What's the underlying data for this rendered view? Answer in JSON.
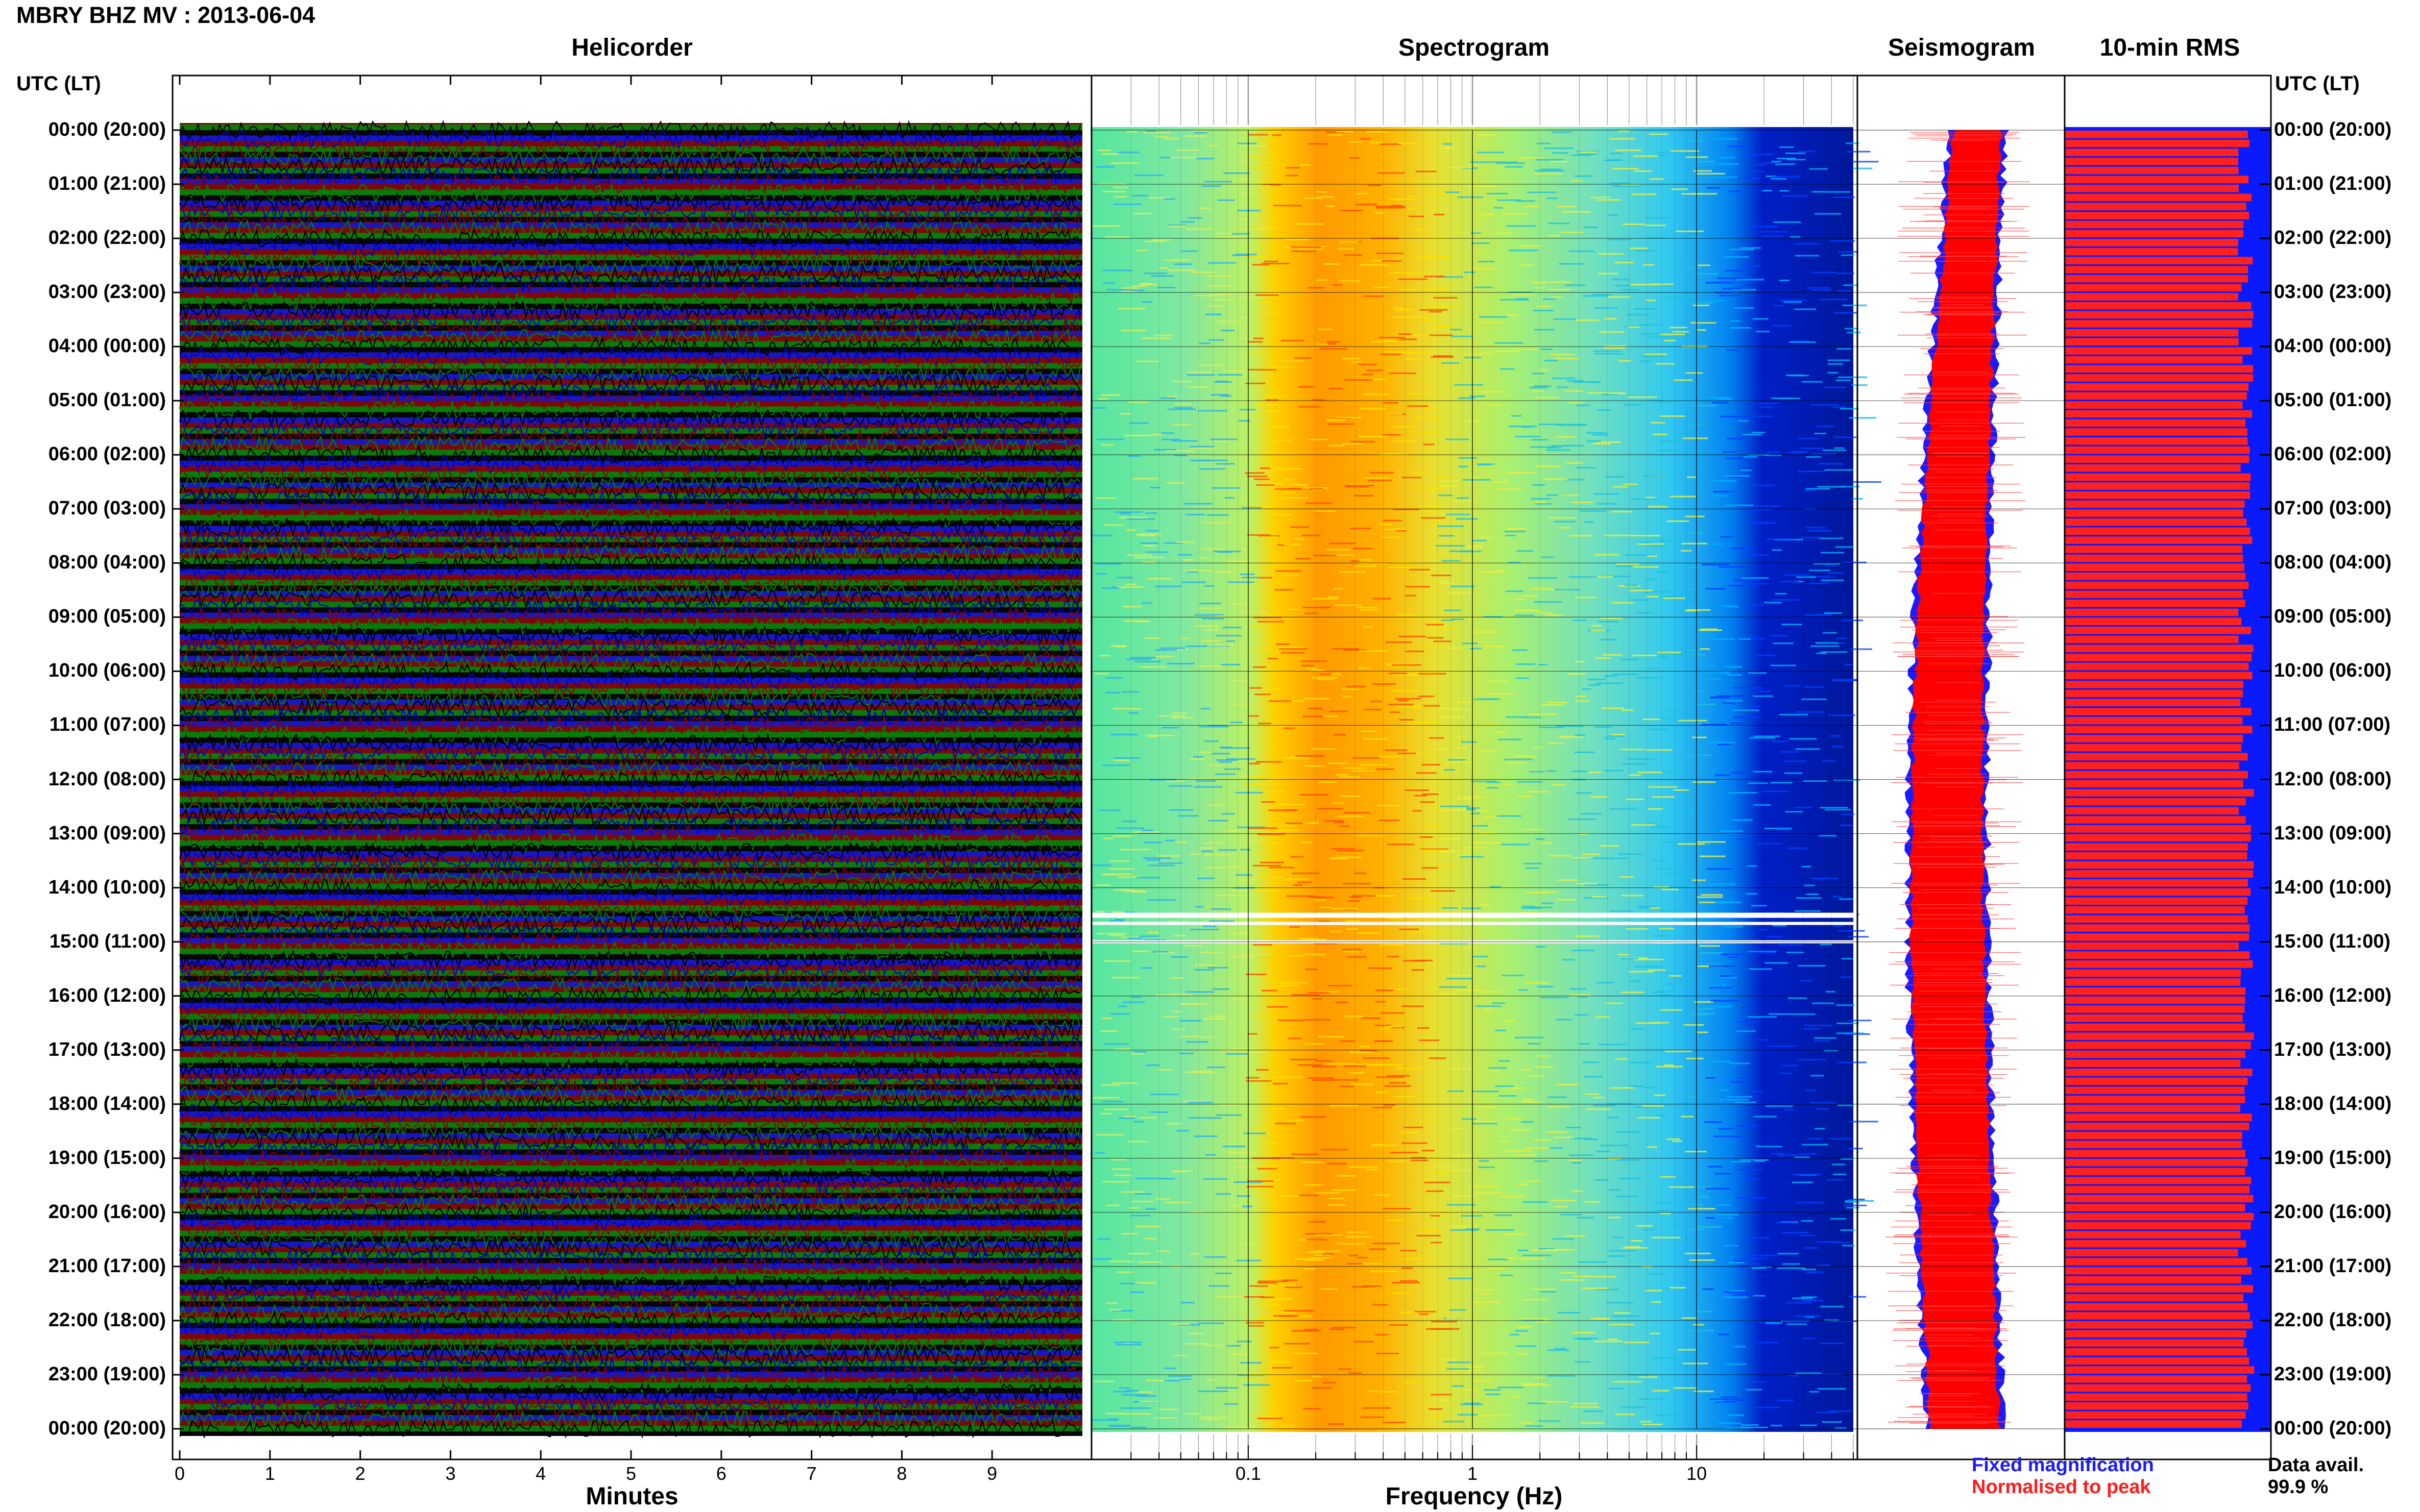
{
  "header": {
    "title": "MBRY BHZ MV : 2013-06-04"
  },
  "panels": {
    "helicorder": "Helicorder",
    "spectrogram": "Spectrogram",
    "seismogram": "Seismogram",
    "rms": "10-min RMS"
  },
  "axes": {
    "left_time_label": "UTC (LT)",
    "right_time_label": "UTC (LT)",
    "helicorder_xlabel": "Minutes",
    "spectrogram_xlabel": "Frequency (Hz)"
  },
  "legend": {
    "fixed": "Fixed magnification",
    "normalised": "Normalised to peak",
    "data_avail_label": "Data avail.",
    "data_avail_value": "99.9 %"
  },
  "colors": {
    "helicorder_traces": [
      "#000000",
      "#0000cc",
      "#8b0000",
      "#008000"
    ],
    "seismogram_fixed": "#1a1aff",
    "seismogram_normalised": "#ff0000",
    "rms_bar": "#ff2020",
    "rms_background": "#0a1aff"
  },
  "time_rows": [
    "00:00 (20:00)",
    "01:00 (21:00)",
    "02:00 (22:00)",
    "03:00 (23:00)",
    "04:00 (00:00)",
    "05:00 (01:00)",
    "06:00 (02:00)",
    "07:00 (03:00)",
    "08:00 (04:00)",
    "09:00 (05:00)",
    "10:00 (06:00)",
    "11:00 (07:00)",
    "12:00 (08:00)",
    "13:00 (09:00)",
    "14:00 (10:00)",
    "15:00 (11:00)",
    "16:00 (12:00)",
    "17:00 (13:00)",
    "18:00 (14:00)",
    "19:00 (15:00)",
    "20:00 (16:00)",
    "21:00 (17:00)",
    "22:00 (18:00)",
    "23:00 (19:00)",
    "00:00 (20:00)"
  ],
  "chart_data": [
    {
      "type": "line",
      "title": "Helicorder",
      "xlabel": "Minutes",
      "x_ticks": [
        "0",
        "1",
        "2",
        "3",
        "4",
        "5",
        "6",
        "7",
        "8",
        "9"
      ],
      "xlim": [
        0,
        10
      ],
      "rows_per_hour": 6,
      "trace_colors_cycle": [
        "black",
        "blue",
        "darkred",
        "green"
      ]
    },
    {
      "type": "heatmap",
      "title": "Spectrogram",
      "xlabel": "Frequency (Hz)",
      "x_scale": "log",
      "x_ticks": [
        "0.1",
        "1",
        "10"
      ],
      "x_tick_values": [
        0.1,
        1,
        10
      ],
      "xlim": [
        0.02,
        50
      ],
      "colormap": "jet",
      "dominant_band_hz": [
        0.2,
        0.6
      ],
      "data_gap_utc": "14:30"
    },
    {
      "type": "area",
      "title": "Seismogram",
      "series": [
        {
          "name": "Fixed magnification"
        },
        {
          "name": "Normalised to peak"
        }
      ]
    },
    {
      "type": "bar",
      "title": "10-min RMS",
      "bars_per_hour": 6,
      "relative_length_range": [
        0.84,
        0.92
      ]
    }
  ]
}
